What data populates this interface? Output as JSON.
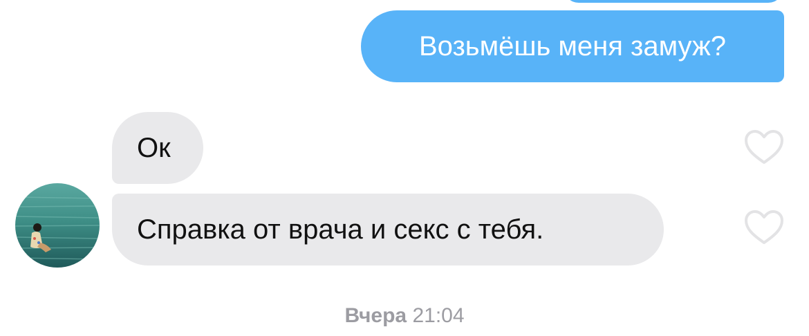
{
  "conversation": {
    "messages": [
      {
        "direction": "outgoing",
        "text": "Возьмёшь меня замуж?"
      },
      {
        "direction": "incoming",
        "text": "Ок"
      },
      {
        "direction": "incoming",
        "text": "Справка от врача и секс с тебя."
      }
    ],
    "timestamp": {
      "day": "Вчера",
      "time": "21:04"
    }
  },
  "icons": {
    "like": "heart-outline-icon",
    "avatar": "contact-avatar-photo"
  },
  "colors": {
    "outgoing_bubble": "#58b3f8",
    "incoming_bubble": "#e9e9eb",
    "heart_stroke": "#e3e3e5",
    "timestamp": "#9c9ca2"
  }
}
